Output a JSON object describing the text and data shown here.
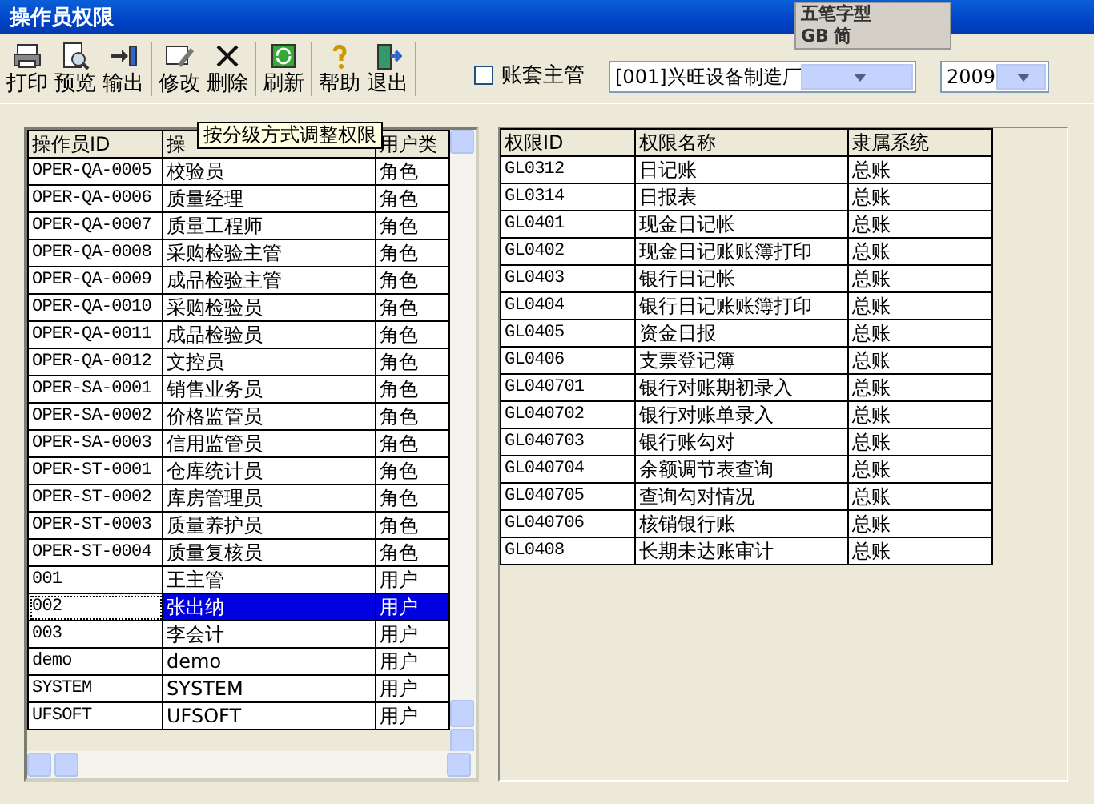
{
  "window": {
    "title": "操作员权限"
  },
  "ime_bar": {
    "mode": "五笔字型",
    "charset": "GB",
    "script": "简"
  },
  "toolbar": {
    "groups": [
      [
        {
          "label": "打印"
        },
        {
          "label": "预览"
        },
        {
          "label": "输出"
        }
      ],
      [
        {
          "label": "修改"
        },
        {
          "label": "删除"
        }
      ],
      [
        {
          "label": "刷新"
        }
      ],
      [
        {
          "label": "帮助"
        },
        {
          "label": "退出"
        }
      ]
    ]
  },
  "master_checkbox": {
    "label": "账套主管",
    "checked": false
  },
  "company_select": {
    "value": "[001]兴旺设备制造厂"
  },
  "year_select": {
    "value": "2009"
  },
  "tooltip": "按分级方式调整权限",
  "operators": {
    "columns": [
      "操作员ID",
      "操",
      "用户类"
    ],
    "rows": [
      {
        "cells": [
          "OPER-QA-0005",
          "校验员",
          "角色"
        ],
        "selected": false
      },
      {
        "cells": [
          "OPER-QA-0006",
          "质量经理",
          "角色"
        ],
        "selected": false
      },
      {
        "cells": [
          "OPER-QA-0007",
          "质量工程师",
          "角色"
        ],
        "selected": false
      },
      {
        "cells": [
          "OPER-QA-0008",
          "采购检验主管",
          "角色"
        ],
        "selected": false
      },
      {
        "cells": [
          "OPER-QA-0009",
          "成品检验主管",
          "角色"
        ],
        "selected": false
      },
      {
        "cells": [
          "OPER-QA-0010",
          "采购检验员",
          "角色"
        ],
        "selected": false
      },
      {
        "cells": [
          "OPER-QA-0011",
          "成品检验员",
          "角色"
        ],
        "selected": false
      },
      {
        "cells": [
          "OPER-QA-0012",
          "文控员",
          "角色"
        ],
        "selected": false
      },
      {
        "cells": [
          "OPER-SA-0001",
          "销售业务员",
          "角色"
        ],
        "selected": false
      },
      {
        "cells": [
          "OPER-SA-0002",
          "价格监管员",
          "角色"
        ],
        "selected": false
      },
      {
        "cells": [
          "OPER-SA-0003",
          "信用监管员",
          "角色"
        ],
        "selected": false
      },
      {
        "cells": [
          "OPER-ST-0001",
          "仓库统计员",
          "角色"
        ],
        "selected": false
      },
      {
        "cells": [
          "OPER-ST-0002",
          "库房管理员",
          "角色"
        ],
        "selected": false
      },
      {
        "cells": [
          "OPER-ST-0003",
          "质量养护员",
          "角色"
        ],
        "selected": false
      },
      {
        "cells": [
          "OPER-ST-0004",
          "质量复核员",
          "角色"
        ],
        "selected": false
      },
      {
        "cells": [
          "001",
          "王主管",
          "用户"
        ],
        "selected": false
      },
      {
        "cells": [
          "002",
          "张出纳",
          "用户"
        ],
        "selected": true
      },
      {
        "cells": [
          "003",
          "李会计",
          "用户"
        ],
        "selected": false
      },
      {
        "cells": [
          "demo",
          "demo",
          "用户"
        ],
        "selected": false
      },
      {
        "cells": [
          "SYSTEM",
          "SYSTEM",
          "用户"
        ],
        "selected": false
      },
      {
        "cells": [
          "UFSOFT",
          "UFSOFT",
          "用户"
        ],
        "selected": false
      }
    ]
  },
  "permissions": {
    "columns": [
      "权限ID",
      "权限名称",
      "隶属系统"
    ],
    "rows": [
      [
        "GL0312",
        "日记账",
        "总账"
      ],
      [
        "GL0314",
        "日报表",
        "总账"
      ],
      [
        "GL0401",
        "现金日记帐",
        "总账"
      ],
      [
        "GL0402",
        "现金日记账账簿打印",
        "总账"
      ],
      [
        "GL0403",
        "银行日记帐",
        "总账"
      ],
      [
        "GL0404",
        "银行日记账账簿打印",
        "总账"
      ],
      [
        "GL0405",
        "资金日报",
        "总账"
      ],
      [
        "GL0406",
        "支票登记簿",
        "总账"
      ],
      [
        "GL040701",
        "银行对账期初录入",
        "总账"
      ],
      [
        "GL040702",
        "银行对账单录入",
        "总账"
      ],
      [
        "GL040703",
        "银行账勾对",
        "总账"
      ],
      [
        "GL040704",
        "余额调节表查询",
        "总账"
      ],
      [
        "GL040705",
        "查询勾对情况",
        "总账"
      ],
      [
        "GL040706",
        "核销银行账",
        "总账"
      ],
      [
        "GL0408",
        "长期未达账审计",
        "总账"
      ]
    ]
  }
}
